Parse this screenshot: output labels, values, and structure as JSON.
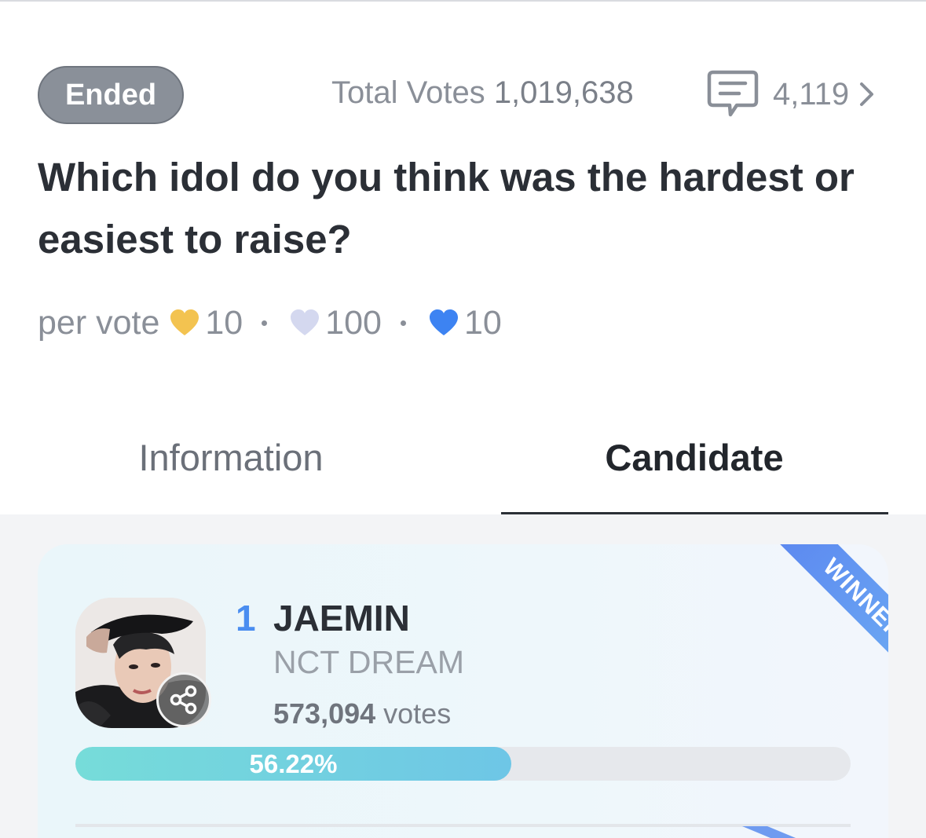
{
  "poll": {
    "status": "Ended",
    "total_votes_label": "Total Votes",
    "total_votes_value": "1,019,638",
    "comment_count": "4,119",
    "title": "Which idol do you think was the hardest or easiest to raise?",
    "per_vote_label": "per vote",
    "costs": [
      {
        "icon": "gold-heart-icon",
        "value": "10",
        "color": "#f3c350"
      },
      {
        "icon": "silver-heart-icon",
        "value": "100",
        "color": "#d4d8ef"
      },
      {
        "icon": "blue-heart-icon",
        "value": "10",
        "color": "#3d83f2"
      }
    ]
  },
  "tabs": {
    "information": "Information",
    "candidate": "Candidate",
    "active": "candidate"
  },
  "candidates": [
    {
      "rank": "1",
      "name": "JAEMIN",
      "group": "NCT DREAM",
      "votes_value": "573,094",
      "votes_label": "votes",
      "percent_label": "56.22%",
      "percent": 56.22,
      "badge": "WINNER"
    }
  ],
  "colors": {
    "accent_blue": "#4a8df0",
    "status_badge": "#8a9099"
  }
}
